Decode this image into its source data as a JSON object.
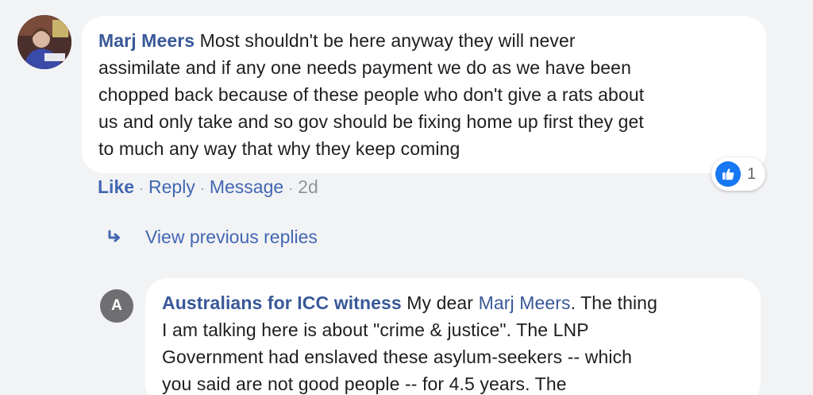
{
  "comment": {
    "author": "Marj Meers",
    "lines": [
      "Most shouldn't be here anyway they will never",
      "assimilate and if any one needs payment we do as we have been",
      "chopped back because of these people who don't give a rats about",
      "us and only take and so gov should be fixing home up first they get",
      "to much any way that why they keep coming"
    ],
    "reaction_count": "1",
    "actions": {
      "like": "Like",
      "reply": "Reply",
      "message": "Message",
      "time": "2d",
      "separator": "·"
    }
  },
  "view_previous_replies": "View previous replies",
  "reply": {
    "avatar_letter": "A",
    "author": "Australians for ICC witness",
    "line1_prefix": "My dear",
    "mention": "Marj Meers",
    "line1_suffix": ". The thing",
    "lines": [
      "I am talking here is about \"crime & justice\". The LNP",
      "Government had enslaved these asylum-seekers -- which",
      "you said are not good people -- for 4.5 years. The"
    ]
  },
  "colors": {
    "background": "#f2f3f5",
    "author_link": "#385898",
    "action_link": "#4267b2",
    "like_blue": "#1877f2"
  }
}
